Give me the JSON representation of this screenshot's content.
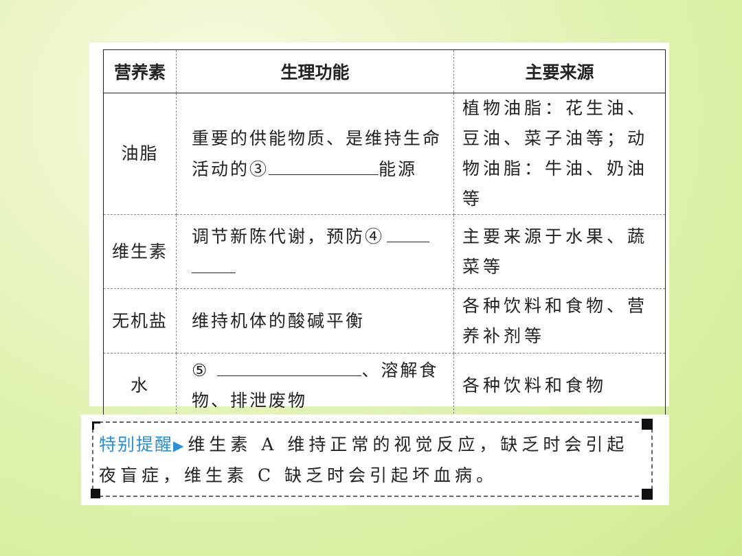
{
  "table": {
    "headers": [
      "营养素",
      "生理功能",
      "主要来源"
    ],
    "rows": [
      {
        "nutrient": "油脂",
        "function_before": "重要的供能物质、是维持生命活动的③",
        "function_after": "能源",
        "source": "植物油脂：花生油、豆油、菜子油等；动物油脂：牛油、奶油等"
      },
      {
        "nutrient": "维生素",
        "function_before": "调节新陈代谢，预防④",
        "function_after": "",
        "source": "主要来源于水果、蔬菜等"
      },
      {
        "nutrient": "无机盐",
        "function_before": "维持机体的酸碱平衡",
        "function_after": "",
        "source": "各种饮料和食物、营养补剂等"
      },
      {
        "nutrient": "水",
        "function_before": "⑤",
        "function_after": "、溶解食物、排泄废物",
        "source": "各种饮料和食物"
      }
    ]
  },
  "tip": {
    "label": "特别提醒",
    "arrow": "▶",
    "text": "维生素 A 维持正常的视觉反应，缺乏时会引起夜盲症，维生素 C 缺乏时会引起坏血病。"
  }
}
